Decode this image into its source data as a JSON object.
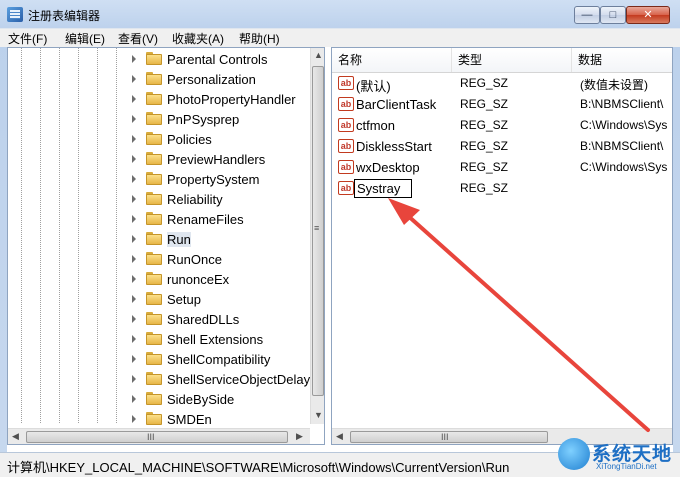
{
  "window": {
    "title": "注册表编辑器",
    "controls": {
      "minimize": "—",
      "maximize": "□",
      "close": "✕"
    }
  },
  "menu": [
    "文件(F)",
    "编辑(E)",
    "查看(V)",
    "收藏夹(A)",
    "帮助(H)"
  ],
  "tree": {
    "items": [
      {
        "label": "Parental Controls",
        "selected": false
      },
      {
        "label": "Personalization",
        "selected": false
      },
      {
        "label": "PhotoPropertyHandler",
        "selected": false
      },
      {
        "label": "PnPSysprep",
        "selected": false
      },
      {
        "label": "Policies",
        "selected": false
      },
      {
        "label": "PreviewHandlers",
        "selected": false
      },
      {
        "label": "PropertySystem",
        "selected": false
      },
      {
        "label": "Reliability",
        "selected": false
      },
      {
        "label": "RenameFiles",
        "selected": false
      },
      {
        "label": "Run",
        "selected": true
      },
      {
        "label": "RunOnce",
        "selected": false
      },
      {
        "label": "runonceEx",
        "selected": false
      },
      {
        "label": "Setup",
        "selected": false
      },
      {
        "label": "SharedDLLs",
        "selected": false
      },
      {
        "label": "Shell Extensions",
        "selected": false
      },
      {
        "label": "ShellCompatibility",
        "selected": false
      },
      {
        "label": "ShellServiceObjectDelayL",
        "selected": false
      },
      {
        "label": "SideBySide",
        "selected": false
      },
      {
        "label": "SMDEn",
        "selected": false
      }
    ],
    "scroll": {
      "up": "▲",
      "down": "▼",
      "left": "◀",
      "right": "▶",
      "grip": "≡",
      "hgrip": "III"
    }
  },
  "values": {
    "columns": [
      "名称",
      "类型",
      "数据"
    ],
    "rows": [
      {
        "name": "(默认)",
        "type": "REG_SZ",
        "data": "(数值未设置)"
      },
      {
        "name": "BarClientTask",
        "type": "REG_SZ",
        "data": "B:\\NBMSClient\\"
      },
      {
        "name": "ctfmon",
        "type": "REG_SZ",
        "data": "C:\\Windows\\Sys"
      },
      {
        "name": "DisklessStart",
        "type": "REG_SZ",
        "data": "B:\\NBMSClient\\"
      },
      {
        "name": "wxDesktop",
        "type": "REG_SZ",
        "data": "C:\\Windows\\Sys"
      }
    ],
    "editing": {
      "name": "Systray",
      "type": "REG_SZ",
      "data": ""
    },
    "icon_text": "ab",
    "scroll": {
      "left": "◀",
      "right": "▶",
      "grip": "III"
    }
  },
  "statusbar": {
    "path": "计算机\\HKEY_LOCAL_MACHINE\\SOFTWARE\\Microsoft\\Windows\\CurrentVersion\\Run"
  },
  "watermark": {
    "title": "系统天地",
    "url": "XiTongTianDi.net"
  },
  "colors": {
    "arrow": "#e8453c",
    "selection": "#dfe6ef"
  }
}
